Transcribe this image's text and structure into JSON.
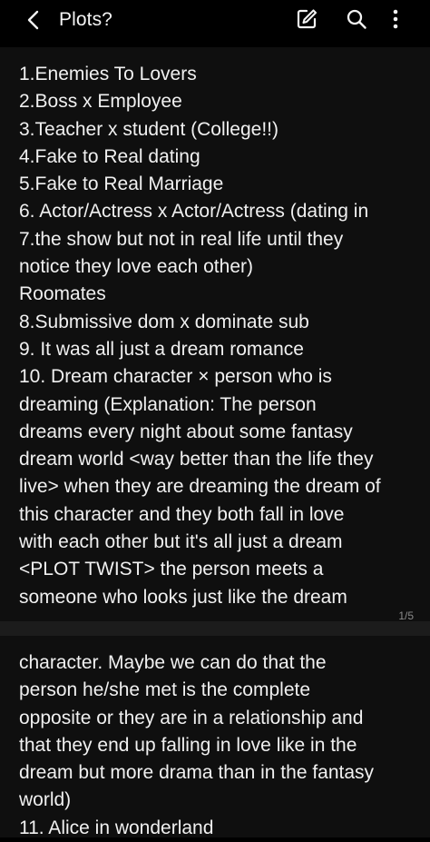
{
  "header": {
    "title": "Plots?",
    "back_icon": "chevron-left-icon",
    "edit_icon": "edit-icon",
    "search_icon": "search-icon",
    "more_icon": "more-vertical-icon"
  },
  "note": {
    "page1_lines": [
      "1.Enemies To Lovers",
      "2.Boss x Employee",
      "3.Teacher x student (College!!)",
      "4.Fake to Real dating",
      "5.Fake to Real Marriage",
      "6. Actor/Actress x Actor/Actress (dating in",
      "7.the show but not in real life until they",
      "notice they love each other)",
      "Roomates",
      "8.Submissive dom x dominate sub",
      "9. It was all just a dream romance",
      "10. Dream character × person who is",
      "dreaming (Explanation: The person",
      "dreams every night about some fantasy",
      "dream world <way better than the life they",
      "live> when they are dreaming the dream of",
      "this character and they both fall in love",
      "with each other but it's all just a dream",
      "<PLOT TWIST> the person meets a",
      "someone who looks just like the dream"
    ],
    "page2_lines": [
      "character. Maybe we can do that the",
      "person he/she met is the complete",
      "opposite or they are in a relationship and",
      "that they end up falling in love like in the",
      "dream but more drama than in the fantasy",
      "world)",
      "11. Alice in wonderland"
    ],
    "page_indicator": "1/5"
  },
  "colors": {
    "background": "#000000",
    "page_background": "#0f0f0f",
    "divider": "#1c1c1c",
    "text": "#f0f0f0",
    "muted": "#8a8a8a"
  }
}
